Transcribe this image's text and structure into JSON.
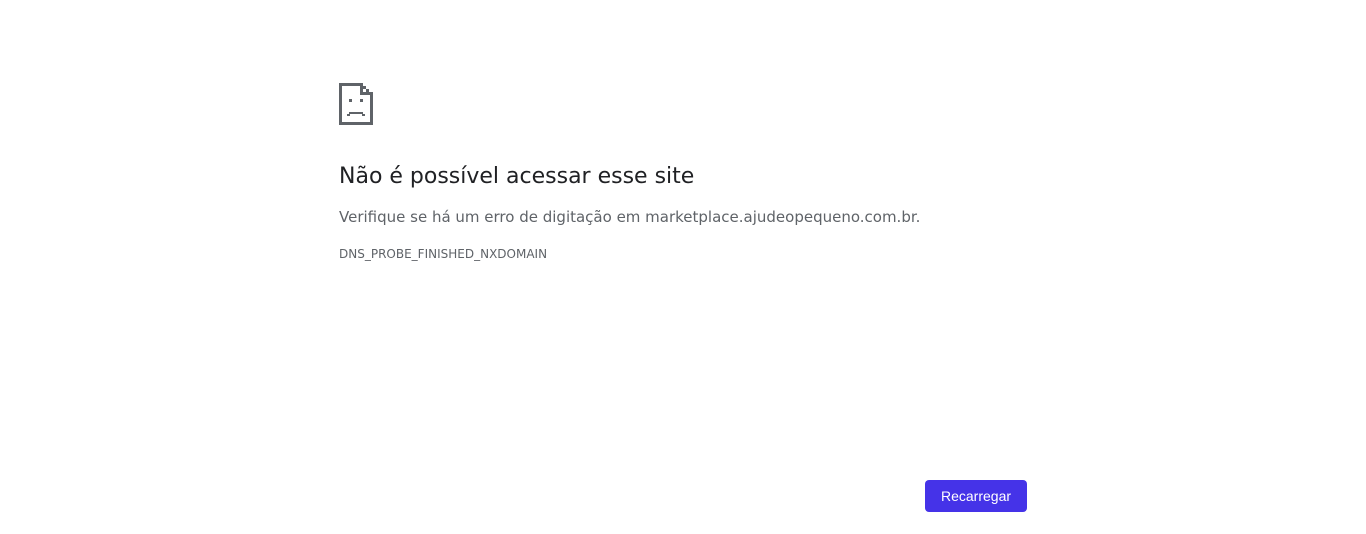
{
  "error": {
    "icon": "sad-page-icon",
    "title": "Não é possível acessar esse site",
    "description": "Verifique se há um erro de digitação em marketplace.ajudeopequeno.com.br.",
    "error_code": "DNS_PROBE_FINISHED_NXDOMAIN"
  },
  "actions": {
    "reload_label": "Recarregar"
  },
  "colors": {
    "accent": "#4533e8",
    "icon": "#5f6368",
    "title": "#202124",
    "text": "#5f6368"
  }
}
